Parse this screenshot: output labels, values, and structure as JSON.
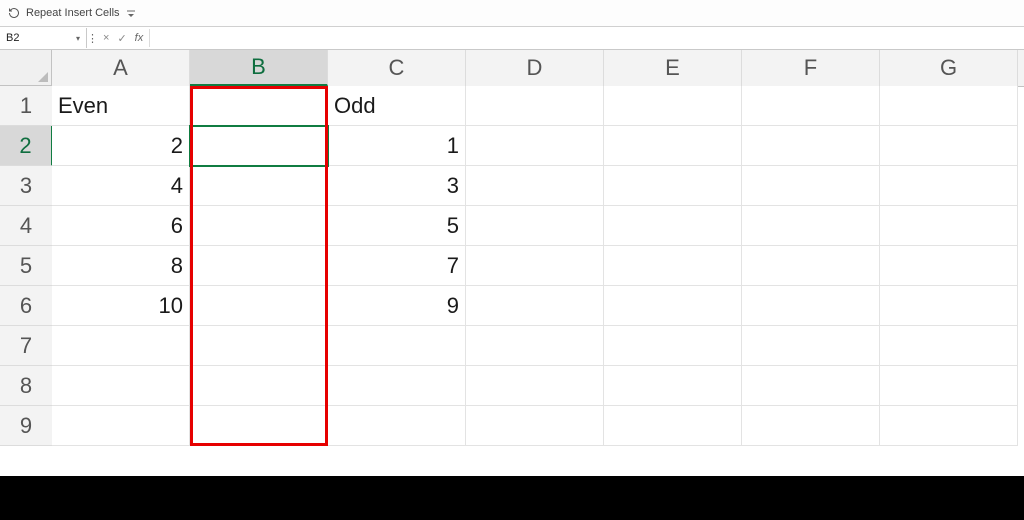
{
  "qat": {
    "undo_label": "Repeat Insert Cells"
  },
  "name_box": {
    "value": "B2"
  },
  "formula_bar": {
    "cancel": "×",
    "confirm": "✓",
    "fx": "fx",
    "value": ""
  },
  "columns": [
    "A",
    "B",
    "C",
    "D",
    "E",
    "F",
    "G"
  ],
  "rows": [
    "1",
    "2",
    "3",
    "4",
    "5",
    "6",
    "7",
    "8",
    "9"
  ],
  "active_cell": {
    "col": 1,
    "row": 1
  },
  "red_box": {
    "col": 1,
    "row_start": 0,
    "row_end": 9
  },
  "cells": [
    [
      {
        "v": "Even",
        "t": "txt"
      },
      {
        "v": "",
        "t": "txt"
      },
      {
        "v": "Odd",
        "t": "txt"
      },
      {
        "v": "",
        "t": "txt"
      },
      {
        "v": "",
        "t": "txt"
      },
      {
        "v": "",
        "t": "txt"
      },
      {
        "v": "",
        "t": "txt"
      }
    ],
    [
      {
        "v": "2",
        "t": "num"
      },
      {
        "v": "",
        "t": "txt"
      },
      {
        "v": "1",
        "t": "num"
      },
      {
        "v": "",
        "t": "txt"
      },
      {
        "v": "",
        "t": "txt"
      },
      {
        "v": "",
        "t": "txt"
      },
      {
        "v": "",
        "t": "txt"
      }
    ],
    [
      {
        "v": "4",
        "t": "num"
      },
      {
        "v": "",
        "t": "txt"
      },
      {
        "v": "3",
        "t": "num"
      },
      {
        "v": "",
        "t": "txt"
      },
      {
        "v": "",
        "t": "txt"
      },
      {
        "v": "",
        "t": "txt"
      },
      {
        "v": "",
        "t": "txt"
      }
    ],
    [
      {
        "v": "6",
        "t": "num"
      },
      {
        "v": "",
        "t": "txt"
      },
      {
        "v": "5",
        "t": "num"
      },
      {
        "v": "",
        "t": "txt"
      },
      {
        "v": "",
        "t": "txt"
      },
      {
        "v": "",
        "t": "txt"
      },
      {
        "v": "",
        "t": "txt"
      }
    ],
    [
      {
        "v": "8",
        "t": "num"
      },
      {
        "v": "",
        "t": "txt"
      },
      {
        "v": "7",
        "t": "num"
      },
      {
        "v": "",
        "t": "txt"
      },
      {
        "v": "",
        "t": "txt"
      },
      {
        "v": "",
        "t": "txt"
      },
      {
        "v": "",
        "t": "txt"
      }
    ],
    [
      {
        "v": "10",
        "t": "num"
      },
      {
        "v": "",
        "t": "txt"
      },
      {
        "v": "9",
        "t": "num"
      },
      {
        "v": "",
        "t": "txt"
      },
      {
        "v": "",
        "t": "txt"
      },
      {
        "v": "",
        "t": "txt"
      },
      {
        "v": "",
        "t": "txt"
      }
    ],
    [
      {
        "v": "",
        "t": "txt"
      },
      {
        "v": "",
        "t": "txt"
      },
      {
        "v": "",
        "t": "txt"
      },
      {
        "v": "",
        "t": "txt"
      },
      {
        "v": "",
        "t": "txt"
      },
      {
        "v": "",
        "t": "txt"
      },
      {
        "v": "",
        "t": "txt"
      }
    ],
    [
      {
        "v": "",
        "t": "txt"
      },
      {
        "v": "",
        "t": "txt"
      },
      {
        "v": "",
        "t": "txt"
      },
      {
        "v": "",
        "t": "txt"
      },
      {
        "v": "",
        "t": "txt"
      },
      {
        "v": "",
        "t": "txt"
      },
      {
        "v": "",
        "t": "txt"
      }
    ],
    [
      {
        "v": "",
        "t": "txt"
      },
      {
        "v": "",
        "t": "txt"
      },
      {
        "v": "",
        "t": "txt"
      },
      {
        "v": "",
        "t": "txt"
      },
      {
        "v": "",
        "t": "txt"
      },
      {
        "v": "",
        "t": "txt"
      },
      {
        "v": "",
        "t": "txt"
      }
    ]
  ]
}
